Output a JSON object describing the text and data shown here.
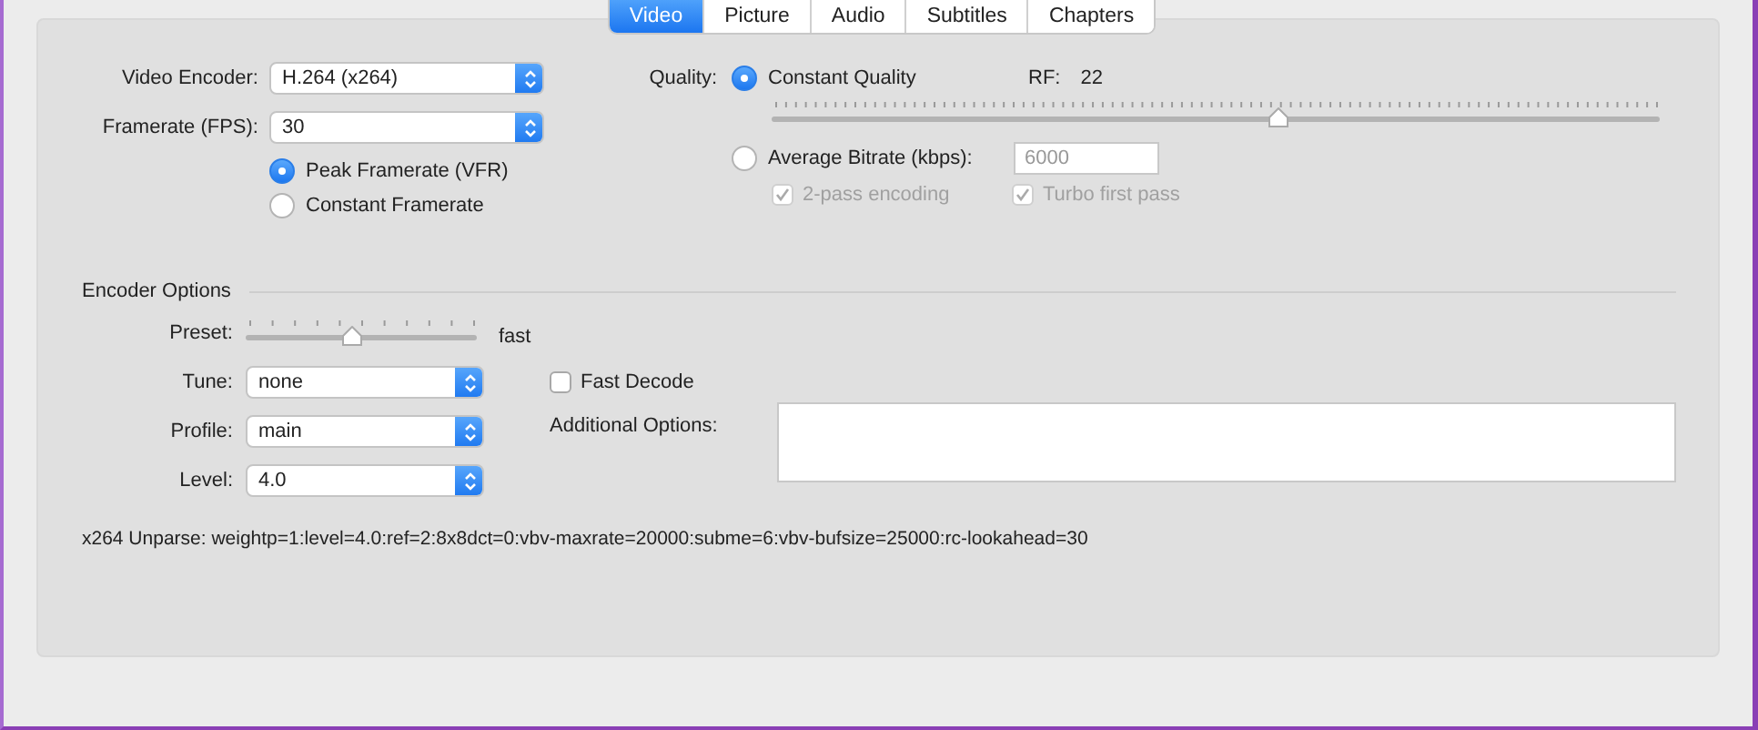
{
  "tabs": [
    {
      "label": "Video",
      "selected": true
    },
    {
      "label": "Picture",
      "selected": false
    },
    {
      "label": "Audio",
      "selected": false
    },
    {
      "label": "Subtitles",
      "selected": false
    },
    {
      "label": "Chapters",
      "selected": false
    }
  ],
  "video_encoder": {
    "label": "Video Encoder:",
    "value": "H.264 (x264)"
  },
  "framerate": {
    "label": "Framerate (FPS):",
    "value": "30"
  },
  "framerate_modes": [
    {
      "label": "Peak Framerate (VFR)",
      "selected": true
    },
    {
      "label": "Constant Framerate",
      "selected": false
    }
  ],
  "quality": {
    "label": "Quality:",
    "constant_quality": {
      "label": "Constant Quality",
      "selected": true,
      "rf_label": "RF:",
      "rf_value": "22",
      "level": 0.57
    },
    "average_bitrate": {
      "label": "Average Bitrate (kbps):",
      "selected": false,
      "placeholder": "6000"
    },
    "options": [
      {
        "label": "2-pass encoding",
        "checked": true,
        "disabled": true
      },
      {
        "label": "Turbo first pass",
        "checked": true,
        "disabled": true
      }
    ]
  },
  "encoder_options": {
    "title": "Encoder Options",
    "preset": {
      "label": "Preset:",
      "level": 0.46,
      "value": "fast"
    },
    "tune": {
      "label": "Tune:",
      "value": "none"
    },
    "fast_decode": {
      "label": "Fast Decode",
      "checked": false
    },
    "profile": {
      "label": "Profile:",
      "value": "main"
    },
    "additional_options": {
      "label": "Additional Options:"
    },
    "level": {
      "label": "Level:",
      "value": "4.0"
    }
  },
  "unparse": "x264 Unparse: weightp=1:level=4.0:ref=2:8x8dct=0:vbv-maxrate=20000:subme=6:vbv-bufsize=25000:rc-lookahead=30"
}
